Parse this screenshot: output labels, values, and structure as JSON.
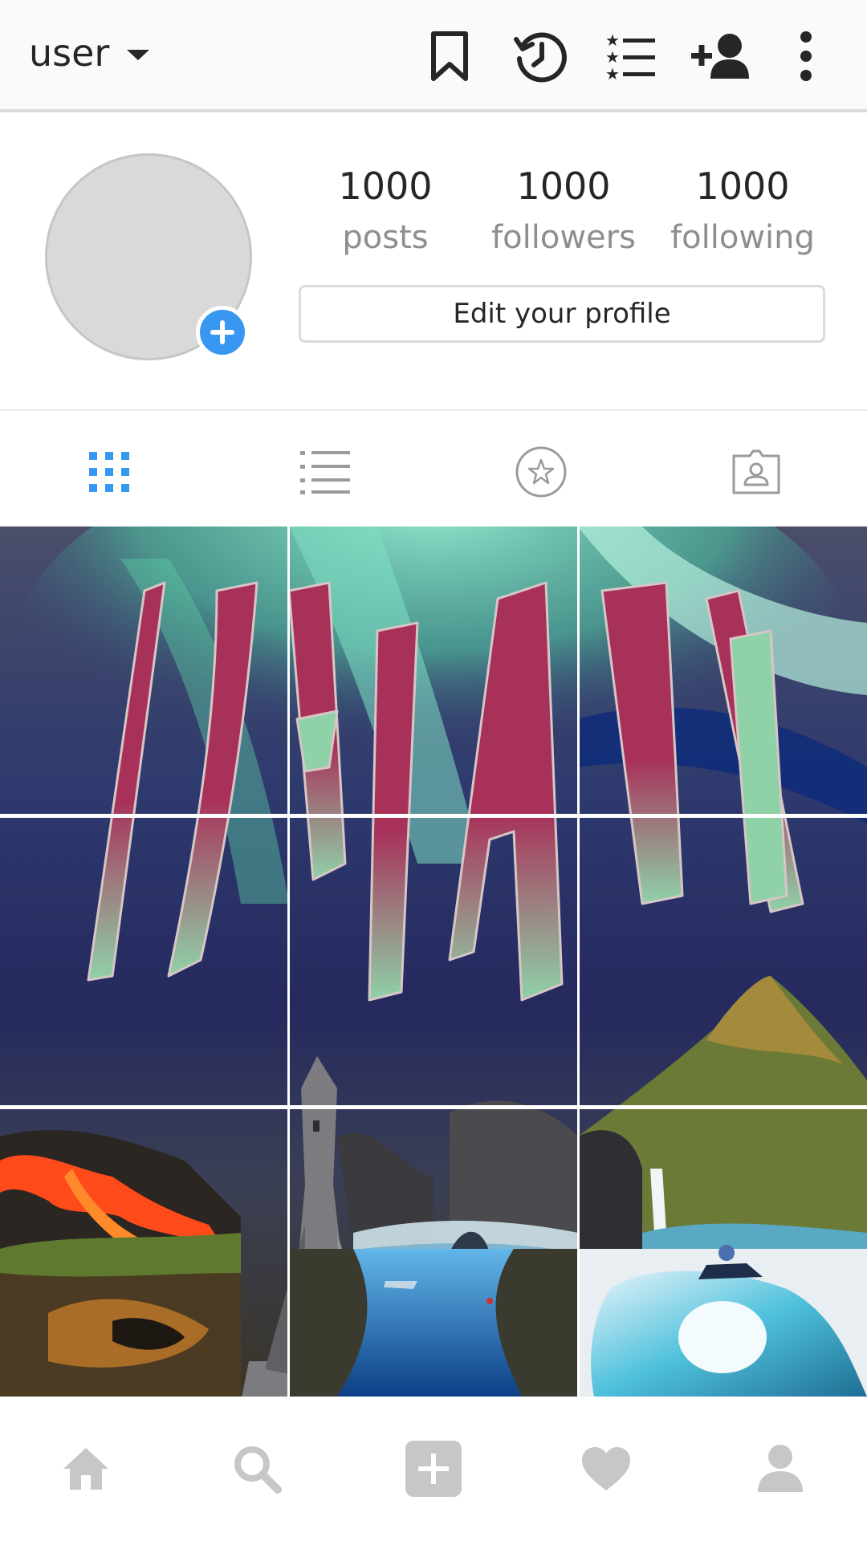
{
  "header": {
    "username": "user",
    "icons": [
      "bookmark-icon",
      "history-icon",
      "close-friends-list-icon",
      "add-user-icon",
      "more-options-icon"
    ]
  },
  "profile": {
    "stats": [
      {
        "value": "1000",
        "label": "posts"
      },
      {
        "value": "1000",
        "label": "followers"
      },
      {
        "value": "1000",
        "label": "following"
      }
    ],
    "edit_label": "Edit your profile",
    "add_icon": "plus-icon"
  },
  "tabs": {
    "active": "grid",
    "items": [
      {
        "name": "grid",
        "icon": "grid-icon"
      },
      {
        "name": "list",
        "icon": "list-icon"
      },
      {
        "name": "favorites",
        "icon": "star-icon"
      },
      {
        "name": "tagged",
        "icon": "tagged-user-icon"
      }
    ]
  },
  "grid": {
    "overlay_text": "ICELAND",
    "posts": [
      {
        "subject": "helicopter over aurora"
      },
      {
        "subject": "aurora sky"
      },
      {
        "subject": "aurora over ocean"
      },
      {
        "subject": "lava field"
      },
      {
        "subject": "church and lagoon"
      },
      {
        "subject": "mountain and waterfall"
      },
      {
        "subject": "lava cave"
      },
      {
        "subject": "fissure snorkeling"
      },
      {
        "subject": "ice cave and snowmobile"
      }
    ]
  },
  "bottom_nav": {
    "items": [
      "home-icon",
      "search-icon",
      "new-post-icon",
      "activity-heart-icon",
      "profile-icon"
    ]
  },
  "colors": {
    "accent": "#3897f0",
    "aurora_green": "#7fe0c4",
    "letter_magenta": "#a8315a",
    "lava": "#ff4a1a",
    "water": "#1e7fd6",
    "icon_gray": "#c7c7c7"
  }
}
